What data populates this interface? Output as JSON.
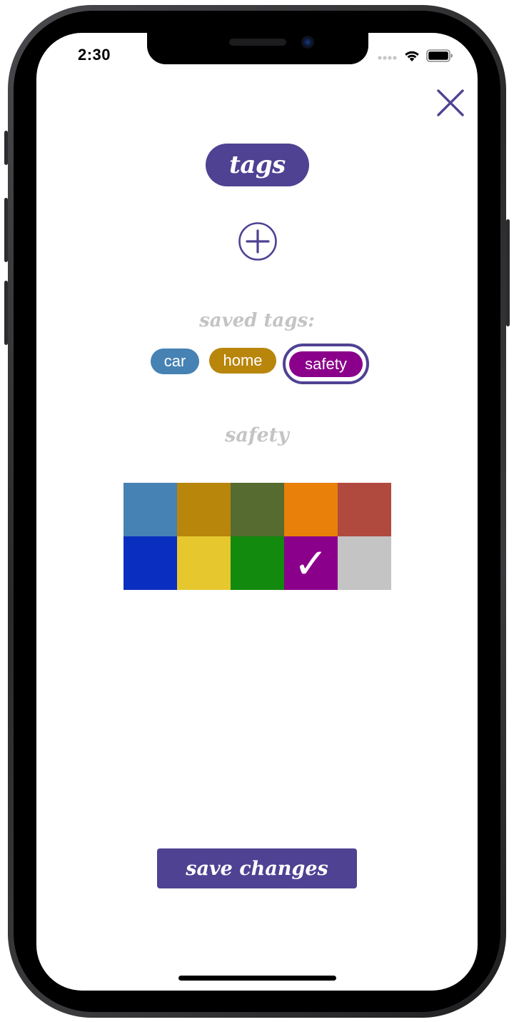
{
  "status_bar": {
    "time": "2:30",
    "signal_icon": "signal-icon",
    "wifi_icon": "wifi-icon",
    "battery_icon": "battery-icon"
  },
  "header": {
    "close_icon": "close-icon",
    "title": "tags"
  },
  "add_button": {
    "icon": "plus-circle-icon"
  },
  "saved_tags": {
    "label": "saved tags:",
    "items": [
      {
        "label": "car",
        "color": "#4682b4"
      },
      {
        "label": "home",
        "color": "#b8860b"
      },
      {
        "label": "safety",
        "color": "#8b008b",
        "selected": true
      }
    ]
  },
  "editor": {
    "selected_tag_name": "safety",
    "palette": [
      {
        "color": "#4682b4",
        "selected": false
      },
      {
        "color": "#b8860b",
        "selected": false
      },
      {
        "color": "#556b2f",
        "selected": false
      },
      {
        "color": "#e8800a",
        "selected": false
      },
      {
        "color": "#b04a3f",
        "selected": false
      },
      {
        "color": "#0a2fc0",
        "selected": false
      },
      {
        "color": "#e6c82e",
        "selected": false
      },
      {
        "color": "#118a0d",
        "selected": false
      },
      {
        "color": "#8b008b",
        "selected": true
      },
      {
        "color": "#c4c4c4",
        "selected": false
      }
    ],
    "check_glyph": "✓"
  },
  "footer": {
    "save_label": "save changes"
  },
  "colors": {
    "accent": "#4f4293",
    "muted_text": "#c4c4c4"
  }
}
